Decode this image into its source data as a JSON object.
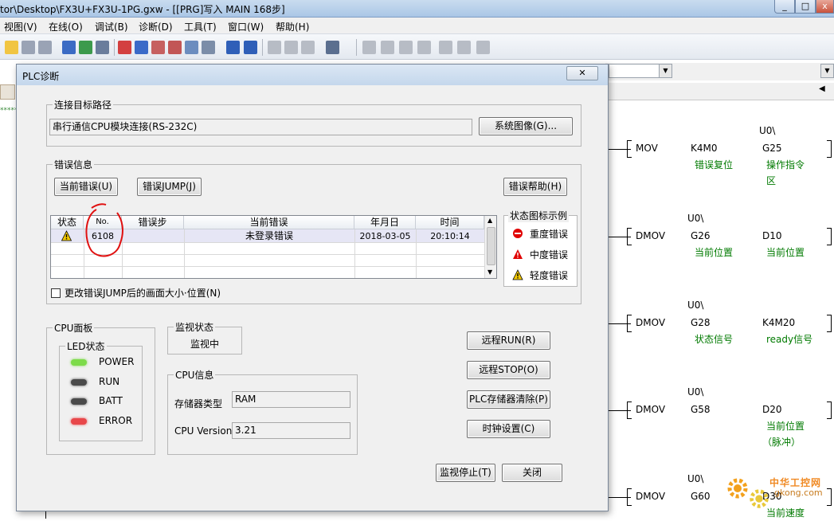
{
  "window": {
    "title": "tor\\Desktop\\FX3U+FX3U-1PG.gxw - [[PRG]写入 MAIN 168步]"
  },
  "menu": [
    "视图(V)",
    "在线(O)",
    "调试(B)",
    "诊断(D)",
    "工具(T)",
    "窗口(W)",
    "帮助(H)"
  ],
  "dialog": {
    "title": "PLC诊断",
    "close_label": "...",
    "connection": {
      "group_label": "连接目标路径",
      "path_value": "串行通信CPU模块连接(RS-232C)",
      "system_image_button": "系统图像(G)..."
    },
    "error_info": {
      "group_label": "错误信息",
      "current_error_button": "当前错误(U)",
      "error_jump_button": "错误JUMP(J)",
      "error_help_button": "错误帮助(H)",
      "columns": [
        "状态",
        "No.",
        "错误步",
        "当前错误",
        "年月日",
        "时间"
      ],
      "rows": [
        {
          "status": "warning-icon",
          "no": "6108",
          "step": "",
          "error": "未登录错误",
          "date": "2018-03-05",
          "time": "20:10:14"
        }
      ],
      "legend_label": "状态图标示例",
      "legend": [
        {
          "icon": "error-icon",
          "label": "重度错误",
          "color": "#e00000"
        },
        {
          "icon": "moderate-error-icon",
          "label": "中度错误",
          "color": "#e00000"
        },
        {
          "icon": "warning-icon",
          "label": "轻度错误",
          "color": "#f2c800"
        }
      ],
      "resize_checkbox_label": "更改错误JUMP后的画面大小·位置(N)",
      "resize_checkbox_checked": false
    },
    "cpu_panel": {
      "group_label": "CPU面板",
      "led_group_label": "LED状态",
      "leds": [
        {
          "name": "POWER",
          "color": "#7ddb4a"
        },
        {
          "name": "RUN",
          "color": "#4a4a4a"
        },
        {
          "name": "BATT",
          "color": "#4a4a4a"
        },
        {
          "name": "ERROR",
          "color": "#e8474a"
        }
      ]
    },
    "monitor_status": {
      "group_label": "监视状态",
      "value": "监视中"
    },
    "cpu_info": {
      "group_label": "CPU信息",
      "memory_type_label": "存储器类型",
      "memory_type_value": "RAM",
      "cpu_version_label": "CPU Version",
      "cpu_version_value": "3.21"
    },
    "buttons": {
      "remote_run": "远程RUN(R)",
      "remote_stop": "远程STOP(O)",
      "plc_memory_clear": "PLC存储器清除(P)",
      "clock_setting": "时钟设置(C)",
      "stop_monitor": "监视停止(T)",
      "close": "关闭"
    }
  },
  "ladder": {
    "rungs": [
      {
        "instr": "MOV",
        "op1": "K4M0",
        "op2": "G25",
        "prefix2": "U0\\",
        "comment1": "错误复位",
        "comment2": [
          "操作指令",
          "区"
        ]
      },
      {
        "instr": "DMOV",
        "op1": "G26",
        "op2": "D10",
        "prefix1": "U0\\",
        "comment1": "当前位置",
        "comment2": [
          "当前位置"
        ]
      },
      {
        "instr": "DMOV",
        "op1": "G28",
        "op2": "K4M20",
        "prefix1": "U0\\",
        "comment1": "状态信号",
        "comment2": [
          "ready信号"
        ]
      },
      {
        "instr": "DMOV",
        "op1": "G58",
        "op2": "D20",
        "prefix1": "U0\\",
        "comment1": "",
        "comment2": [
          "当前位置",
          "（脉冲）"
        ]
      },
      {
        "instr": "DMOV",
        "op1": "G60",
        "op2": "D30",
        "prefix1": "U0\\",
        "comment1": "",
        "comment2": [
          "当前速度"
        ]
      }
    ],
    "asterisks": "*****"
  },
  "watermark": {
    "text": "中华工控网",
    "url": "gkong.com"
  }
}
